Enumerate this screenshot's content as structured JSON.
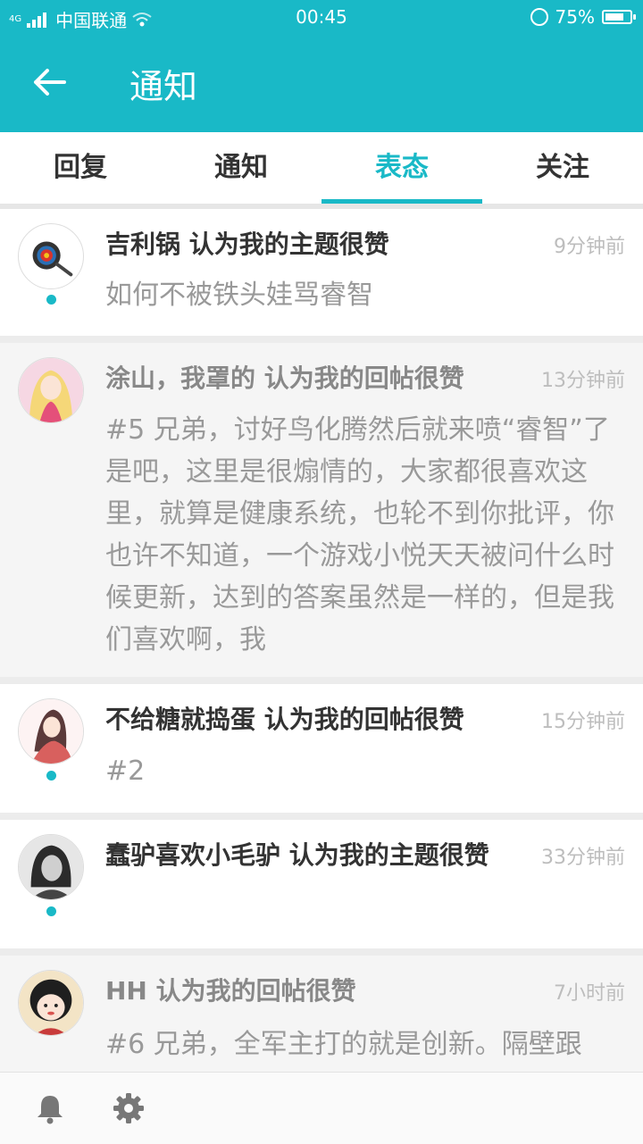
{
  "status_bar": {
    "carrier": "中国联通",
    "network": "4G",
    "time": "00:45",
    "battery": "75%",
    "battery_level": 0.75
  },
  "header": {
    "title": "通知",
    "back_icon": "arrow-left-icon"
  },
  "tabs": [
    {
      "label": "回复",
      "active": false
    },
    {
      "label": "通知",
      "active": false
    },
    {
      "label": "表态",
      "active": true
    },
    {
      "label": "关注",
      "active": false
    }
  ],
  "items": [
    {
      "title": "吉利锅 认为我的主题很赞",
      "time": "9分钟前",
      "body": "如何不被铁头娃骂睿智",
      "unread": true
    },
    {
      "title": "涂山，我罩的 认为我的回帖很赞",
      "time": "13分钟前",
      "body": "#5 兄弟，讨好鸟化腾然后就来喷“睿智”了是吧，这里是很煽情的，大家都很喜欢这里，就算是健康系统，也轮不到你批评，你也许不知道，一个游戏小悦天天被问什么时候更新，达到的答案虽然是一样的，但是我们喜欢啊，我",
      "unread": false
    },
    {
      "title": "不给糖就捣蛋 认为我的回帖很赞",
      "time": "15分钟前",
      "body": "#2",
      "unread": true
    },
    {
      "title": "蠢驴喜欢小毛驴 认为我的主题很赞",
      "time": "33分钟前",
      "body": "",
      "unread": true
    },
    {
      "title": "HH 认为我的回帖很赞",
      "time": "7小时前",
      "body": "#6 兄弟，全军主打的就是创新。隔壁跟",
      "unread": false
    }
  ],
  "bottom_bar": {
    "icons": [
      "bell-icon",
      "gear-icon"
    ]
  },
  "colors": {
    "accent": "#19b9c7"
  }
}
